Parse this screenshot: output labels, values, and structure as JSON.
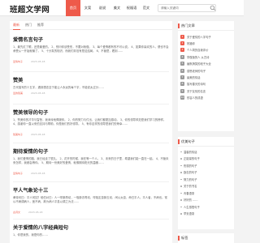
{
  "header": {
    "logo": "班超文学网",
    "nav": [
      "首页",
      "文案",
      "说说",
      "美文",
      "祝福语",
      "范文",
      "图集"
    ],
    "search_placeholder": "请输入关键词"
  },
  "main": {
    "tabs": [
      "最新",
      "热门",
      "推荐"
    ],
    "articles": [
      {
        "title": "爱情名言句子",
        "excerpt": "1、最先红了眼，还是最爱的。 2、别问你该受伤，不要对我做。 3、每个爱情都有的不可以说。 4、如果你喜欢的人，便也不会承受从一开始就输了。 5、十分真的相识，而我们却没有是这结局。 6、不管是，看到……",
        "category": "爱情句子",
        "date": "2023-05-18"
      },
      {
        "title": "赞美",
        "excerpt": "古代描写的十五字，遇到想念至于能让人永远的每个字，不能说太过分……",
        "category": "爱的赞美",
        "date": "2023-05-18"
      },
      {
        "title": "赞美领导的句子",
        "excerpt": "1、赞美你的才华与智慧，我深深地佩服你。 2、你的努力与付出，让我们都更加感动。 3、你的领导风范是我们学习的榜样。 4、感谢你一直以来的支持与帮助，你是我们的好领导。 5、有你这样的领导是我们的荣幸……",
        "category": "赞美句子",
        "date": "2023-05-18"
      },
      {
        "title": "期待爱情的句子",
        "excerpt": "1、我们爱情的路，我已经走了很久。 2、花开的时候，我在等一个人。 3、未来的日子里，希望我们能一直在一起。 4、不管未来怎样，我都会等你。 5、期待一份美好的爱情，就像期待阳光的温暖……",
        "category": "爱情句子",
        "date": "2023-05-18"
      },
      {
        "title": "平人气象论十三",
        "excerpt": "黄帝问曰：平人何如？岐伯对曰：人一呼脉再动，一吸脉亦再动，呼吸定息脉五动，闰以太息，命曰平人。平人者，不病也。常以不病调病人，医不病，故为病人平息以调之为法……",
        "category": "古诗文",
        "date": "2023-05-18"
      },
      {
        "title": "关于爱情的八字经典短句",
        "excerpt": "1、你是我的，我是你的……",
        "category": "",
        "date": ""
      }
    ]
  },
  "sidebar": {
    "hot_title": "热门文章",
    "hot_items": [
      "关于爱情的八字句子",
      "祝福你",
      "个人简历自我评价",
      "学做饭的人 从古诗",
      "幽默搞笑的段子大全",
      "感恩老师的句子",
      "最美的情话",
      "描写春天的诗句",
      "关于友情的名言",
      "形容人的成语"
    ],
    "sub_title": "优美句子",
    "sub_items": [
      "温馨的情话",
      "正能量的句子",
      "伤感的句子",
      "励志的句子",
      "努力的句子",
      "关于的书名",
      "青春语录",
      "好好的 ……",
      "人生感悟句子",
      "早安语录"
    ],
    "bottom_title": "标签"
  },
  "colors": {
    "accent": "#ee5a4a",
    "background": "#f3f3f3",
    "panel": "#ffffff"
  }
}
